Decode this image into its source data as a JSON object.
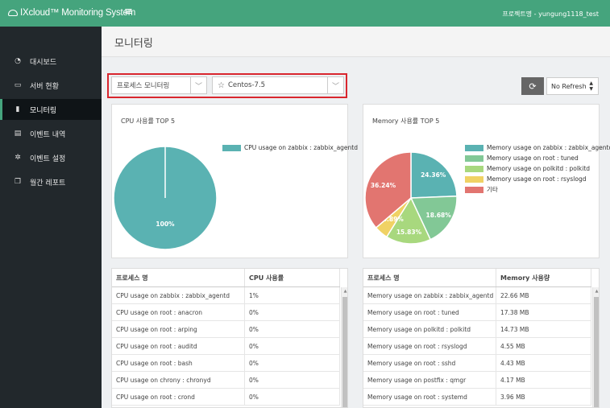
{
  "header": {
    "brand": "IXcloud™ Monitoring System",
    "project": "프로젝트명 - yungung1118_test"
  },
  "sidebar": {
    "items": [
      {
        "label": "대시보드",
        "icon": "dashboard-icon",
        "glyph": "◔"
      },
      {
        "label": "서버 현황",
        "icon": "monitor-icon",
        "glyph": "▭"
      },
      {
        "label": "모니터링",
        "icon": "bar-chart-icon",
        "glyph": "▮"
      },
      {
        "label": "이벤트 내역",
        "icon": "book-icon",
        "glyph": "▤"
      },
      {
        "label": "이벤트 설정",
        "icon": "gear-icon",
        "glyph": "✲"
      },
      {
        "label": "월간 레포트",
        "icon": "file-copy-icon",
        "glyph": "❐"
      }
    ],
    "active_index": 2
  },
  "page": {
    "title": "모니터링"
  },
  "filters": {
    "monitor_type": "프로세스 모니터링",
    "server": "Centos-7.5"
  },
  "refresh": {
    "selected": "No Refresh"
  },
  "cpu_card": {
    "title": "CPU 사용률 TOP 5"
  },
  "mem_card": {
    "title": "Memory 사용률 TOP 5"
  },
  "chart_data": [
    {
      "type": "pie",
      "title": "CPU 사용률 TOP 5",
      "labels": [
        "CPU usage on zabbix : zabbix_agentd"
      ],
      "values": [
        100
      ],
      "slice_labels": [
        "100%"
      ],
      "colors": [
        "#5ab2b2"
      ],
      "legend": "top-right"
    },
    {
      "type": "pie",
      "title": "Memory 사용률 TOP 5",
      "labels": [
        "Memory usage on zabbix : zabbix_agentd",
        "Memory usage on root : tuned",
        "Memory usage on polkitd : polkitd",
        "Memory usage on root : rsyslogd",
        "기타"
      ],
      "values": [
        24.36,
        18.68,
        15.83,
        4.89,
        36.24
      ],
      "slice_labels": [
        "24.36%",
        "18.68%",
        "15.83%",
        "4.89%",
        "36.24%"
      ],
      "colors": [
        "#5ab2b2",
        "#82c896",
        "#a8d87e",
        "#f0d264",
        "#e27570"
      ],
      "legend": "top-right"
    }
  ],
  "cpu_table": {
    "headers": [
      "프로세스 명",
      "CPU 사용률"
    ],
    "rows": [
      [
        "CPU usage on zabbix : zabbix_agentd",
        "1%"
      ],
      [
        "CPU usage on root : anacron",
        "0%"
      ],
      [
        "CPU usage on root : arping",
        "0%"
      ],
      [
        "CPU usage on root : auditd",
        "0%"
      ],
      [
        "CPU usage on root : bash",
        "0%"
      ],
      [
        "CPU usage on chrony : chronyd",
        "0%"
      ],
      [
        "CPU usage on root : crond",
        "0%"
      ]
    ]
  },
  "mem_table": {
    "headers": [
      "프로세스 명",
      "Memory 사용량"
    ],
    "rows": [
      [
        "Memory usage on zabbix : zabbix_agentd",
        "22.66 MB"
      ],
      [
        "Memory usage on root : tuned",
        "17.38 MB"
      ],
      [
        "Memory usage on polkitd : polkitd",
        "14.73 MB"
      ],
      [
        "Memory usage on root : rsyslogd",
        "4.55 MB"
      ],
      [
        "Memory usage on root : sshd",
        "4.43 MB"
      ],
      [
        "Memory usage on postfix : qmgr",
        "4.17 MB"
      ],
      [
        "Memory usage on root : systemd",
        "3.96 MB"
      ]
    ]
  }
}
